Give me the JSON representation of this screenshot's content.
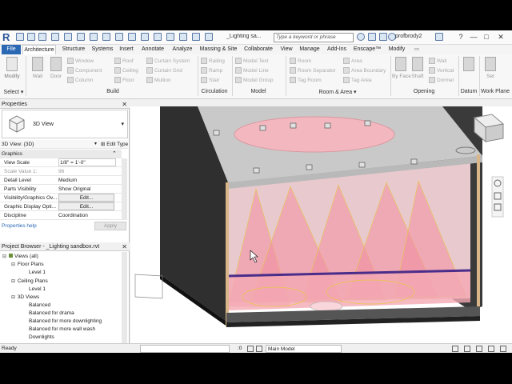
{
  "titlebar": {
    "app_letter": "R",
    "doc_title": "_Lighting sa...",
    "search_placeholder": "Type a keyword or phrase",
    "user": "profbrody2",
    "help_icon": "?",
    "minimize": "—",
    "maximize": "□",
    "close": "✕"
  },
  "tabs": [
    "File",
    "Architecture",
    "Structure",
    "Systems",
    "Insert",
    "Annotate",
    "Analyze",
    "Massing & Site",
    "Collaborate",
    "View",
    "Manage",
    "Add-Ins",
    "Enscape™",
    "Modify"
  ],
  "ribbon": {
    "select": {
      "modify": "Modify",
      "label": "Select ▾"
    },
    "build": {
      "wall": "Wall",
      "door": "Door",
      "window": "Window",
      "component": "Component",
      "column": "Column",
      "roof": "Roof",
      "ceiling": "Ceiling",
      "floor": "Floor",
      "curtain_system": "Curtain System",
      "curtain_grid": "Curtain Grid",
      "mullion": "Mullion",
      "label": "Build"
    },
    "circulation": {
      "railing": "Railing",
      "ramp": "Ramp",
      "stair": "Stair",
      "label": "Circulation"
    },
    "model": {
      "model_text": "Model Text",
      "model_line": "Model Line",
      "model_group": "Model Group",
      "label": "Model"
    },
    "room_area": {
      "room": "Room",
      "room_separator": "Room Separator",
      "tag_room": "Tag Room",
      "area": "Area",
      "area_boundary": "Area Boundary",
      "tag_area": "Tag Area",
      "label": "Room & Area ▾"
    },
    "opening": {
      "by_face": "By Face",
      "shaft": "Shaft",
      "wall": "Wall",
      "vertical": "Vertical",
      "dormer": "Dormer",
      "label": "Opening"
    },
    "datum": {
      "label": "Datum"
    },
    "work_plane": {
      "set": "Set",
      "label": "Work Plane"
    }
  },
  "properties": {
    "title": "Properties",
    "type_name": "3D View",
    "instance_selector": "3D View: {3D}",
    "edit_type": "Edit Type",
    "section": "Graphics",
    "rows": [
      {
        "k": "View Scale",
        "v": "1/8\" = 1'-0\""
      },
      {
        "k": "Scale Value    1:",
        "v": "96"
      },
      {
        "k": "Detail Level",
        "v": "Medium"
      },
      {
        "k": "Parts Visibility",
        "v": "Show Original"
      },
      {
        "k": "Visibility/Graphics Ov...",
        "v": "Edit..."
      },
      {
        "k": "Graphic Display Opti...",
        "v": "Edit..."
      },
      {
        "k": "Discipline",
        "v": "Coordination"
      }
    ],
    "help_link": "Properties help",
    "apply": "Apply"
  },
  "project_browser": {
    "title": "Project Browser - _Lighting sandbox.rvt",
    "items": [
      {
        "label": "Views (all)",
        "level": 0,
        "toggle": "⊟"
      },
      {
        "label": "Floor Plans",
        "level": 1,
        "toggle": "⊟"
      },
      {
        "label": "Level 1",
        "level": 2,
        "toggle": ""
      },
      {
        "label": "Ceiling Plans",
        "level": 1,
        "toggle": "⊟"
      },
      {
        "label": "Level 1",
        "level": 2,
        "toggle": ""
      },
      {
        "label": "3D Views",
        "level": 1,
        "toggle": "⊟"
      },
      {
        "label": "Balanced",
        "level": 2,
        "toggle": ""
      },
      {
        "label": "Balanced for drama",
        "level": 2,
        "toggle": ""
      },
      {
        "label": "Balanced for more downlighting",
        "level": 2,
        "toggle": ""
      },
      {
        "label": "Balanced for more wall wash",
        "level": 2,
        "toggle": ""
      },
      {
        "label": "Downlights",
        "level": 2,
        "toggle": ""
      }
    ]
  },
  "statusbar": {
    "ready": "Ready",
    "zero": ":0",
    "model": "Main Model"
  },
  "colors": {
    "file_tab": "#2a68b4",
    "accent": "#2b5797",
    "beam_fill": "#f2a0b0",
    "beam_line": "#e8c84a",
    "floor_edge": "#4a2d8a"
  }
}
